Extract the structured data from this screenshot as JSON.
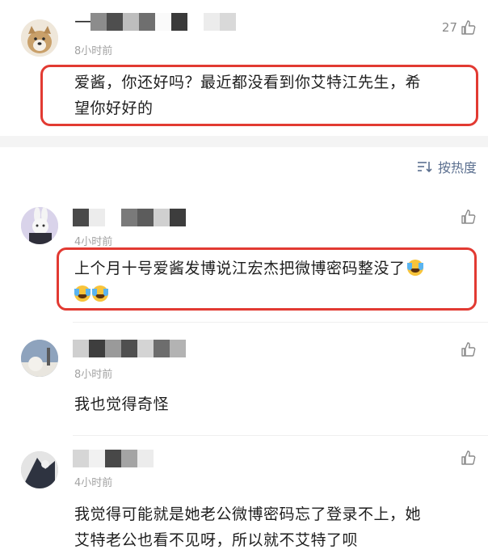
{
  "comments": [
    {
      "username_prefix": "—",
      "time": "8小时前",
      "like_count": "27",
      "text_line1": "爱酱，你还好吗？最近都没看到你艾特江先生，希",
      "text_line2": "望你好好的",
      "highlighted": true
    },
    {
      "time": "4小时前",
      "like_count": "",
      "text_line1": "上个月十号爱酱发博说江宏杰把微博密码整没了",
      "text_line2": "",
      "highlighted": true
    },
    {
      "time": "8小时前",
      "like_count": "",
      "text_line1": "我也觉得奇怪",
      "highlighted": false
    },
    {
      "time": "4小时前",
      "like_count": "",
      "text_line1": "我觉得可能就是她老公微博密码忘了登录不上，她",
      "text_line2": "艾特老公也看不见呀，所以就不艾特了呗",
      "highlighted": false
    }
  ],
  "sort": {
    "label": "按热度",
    "icon": "sort-icon"
  },
  "colors": {
    "highlight_border": "#e23a32",
    "sort_text": "#5b6f8f",
    "time_text": "#a3a3a3"
  }
}
